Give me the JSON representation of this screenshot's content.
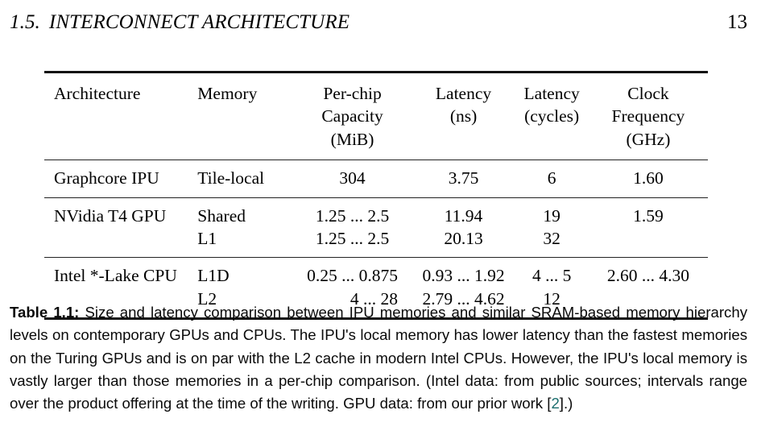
{
  "header": {
    "section_number": "1.5.",
    "section_title": "INTERCONNECT ARCHITECTURE",
    "page_number": "13"
  },
  "table": {
    "columns": [
      {
        "key": "architecture",
        "header_lines": [
          "Architecture"
        ],
        "align": "left"
      },
      {
        "key": "memory",
        "header_lines": [
          "Memory"
        ],
        "align": "left"
      },
      {
        "key": "capacity",
        "header_lines": [
          "Per-chip",
          "Capacity",
          "(MiB)"
        ],
        "align": "center"
      },
      {
        "key": "latency_ns",
        "header_lines": [
          "Latency",
          "(ns)"
        ],
        "align": "center"
      },
      {
        "key": "latency_cycles",
        "header_lines": [
          "Latency",
          "(cycles)"
        ],
        "align": "center"
      },
      {
        "key": "clock",
        "header_lines": [
          "Clock",
          "Frequency",
          "(GHz)"
        ],
        "align": "center"
      }
    ],
    "header": {
      "architecture": "Architecture",
      "memory": "Memory",
      "capacity_l1": "Per-chip",
      "capacity_l2": "Capacity",
      "capacity_l3": "(MiB)",
      "latency_ns_l1": "Latency",
      "latency_ns_l2": "(ns)",
      "latency_cycles_l1": "Latency",
      "latency_cycles_l2": "(cycles)",
      "clock_l1": "Clock",
      "clock_l2": "Frequency",
      "clock_l3": "(GHz)"
    },
    "rows": [
      {
        "architecture": "Graphcore IPU",
        "memory_l1": "Tile-local",
        "memory_l2": "",
        "capacity_l1": "304",
        "capacity_l2": "",
        "latency_ns_l1": "3.75",
        "latency_ns_l2": "",
        "latency_cycles_l1": "6",
        "latency_cycles_l2": "",
        "clock_l1": "1.60",
        "clock_l2": ""
      },
      {
        "architecture": "NVidia T4 GPU",
        "memory_l1": "Shared",
        "memory_l2": "L1",
        "capacity_l1": "1.25 ... 2.5",
        "capacity_l2": "1.25 ... 2.5",
        "latency_ns_l1": "11.94",
        "latency_ns_l2": "20.13",
        "latency_cycles_l1": "19",
        "latency_cycles_l2": "32",
        "clock_l1": "1.59",
        "clock_l2": ""
      },
      {
        "architecture": "Intel *-Lake CPU",
        "memory_l1": "L1D",
        "memory_l2": "L2",
        "capacity_l1": "0.25 ... 0.875",
        "capacity_l2": "4 ... 28",
        "latency_ns_l1": "0.93 ... 1.92",
        "latency_ns_l2": "2.79 ... 4.62",
        "latency_cycles_l1": "4 ... 5",
        "latency_cycles_l2": "12",
        "clock_l1": "2.60 ... 4.30",
        "clock_l2": ""
      }
    ]
  },
  "caption": {
    "label": "Table 1.1:",
    "text_before_cite": " Size and latency comparison between IPU memories and similar SRAM-based memory hierarchy levels on contemporary GPUs and CPUs. The IPU's local memory has lower latency than the fastest memories on the Turing GPUs and is on par with the L2 cache in modern Intel CPUs. However, the IPU's local memory is vastly larger than those memories in a per-chip comparison. (Intel data: from public sources; intervals range over the product offering at the time of the writing. GPU data: from our prior work [",
    "cite": "2",
    "text_after_cite": "].)"
  },
  "colors": {
    "text": "#000000",
    "rule": "#111111",
    "citation": "#1a6e6e",
    "background": "#ffffff"
  }
}
